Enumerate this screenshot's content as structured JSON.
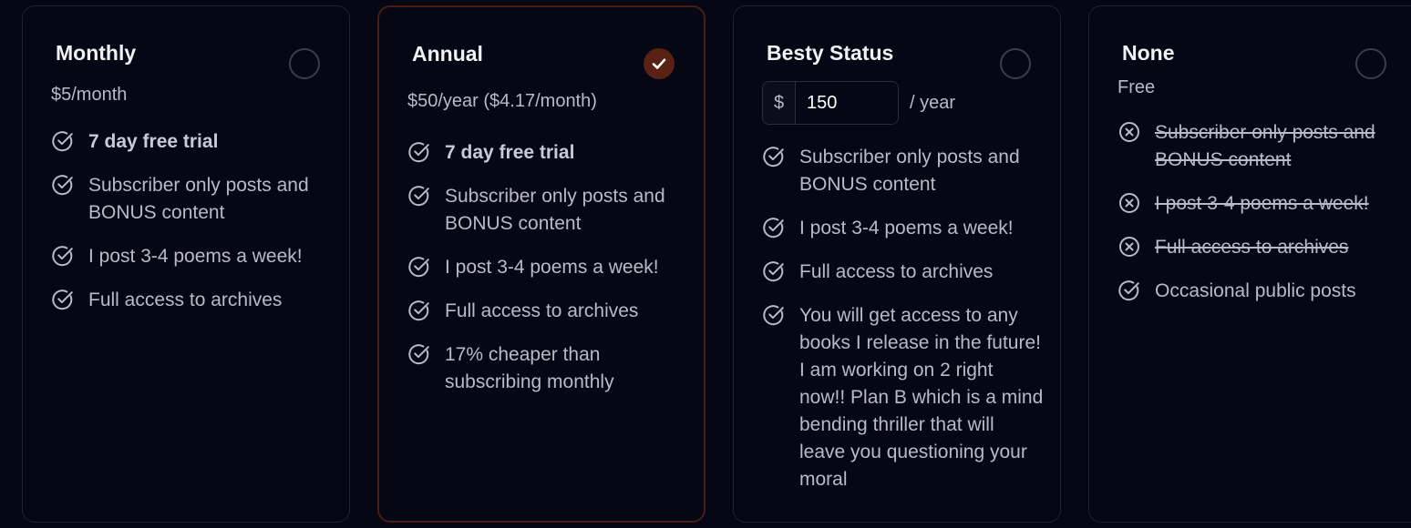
{
  "colors": {
    "background": "#050714",
    "card_border": "#20232f",
    "selected_border": "#4a1d12",
    "selected_radio": "#5a2214",
    "text": "#b9bac4",
    "title": "#f1f1f5"
  },
  "plans": [
    {
      "title": "Monthly",
      "price": "$5/month",
      "selected": false,
      "features": [
        {
          "text": "7 day free trial",
          "icon": "check-circle-icon",
          "bold": true
        },
        {
          "text": "Subscriber only posts and BONUS content",
          "icon": "check-circle-icon"
        },
        {
          "text": "I post 3-4 poems a week!",
          "icon": "check-circle-icon"
        },
        {
          "text": "Full access to archives",
          "icon": "check-circle-icon"
        }
      ]
    },
    {
      "title": "Annual",
      "price": "$50/year ($4.17/month)",
      "selected": true,
      "features": [
        {
          "text": "7 day free trial",
          "icon": "check-circle-icon",
          "bold": true
        },
        {
          "text": "Subscriber only posts and BONUS content",
          "icon": "check-circle-icon"
        },
        {
          "text": "I post 3-4 poems a week!",
          "icon": "check-circle-icon"
        },
        {
          "text": "Full access to archives",
          "icon": "check-circle-icon"
        },
        {
          "text": "17% cheaper than subscribing monthly",
          "icon": "check-circle-icon"
        }
      ]
    },
    {
      "title": "Besty Status",
      "selected": false,
      "amount": {
        "currency": "$",
        "value": "150",
        "period": "/ year"
      },
      "features": [
        {
          "text": "Subscriber only posts and BONUS content",
          "icon": "check-circle-icon"
        },
        {
          "text": "I post 3-4 poems a week!",
          "icon": "check-circle-icon"
        },
        {
          "text": "Full access to archives",
          "icon": "check-circle-icon"
        },
        {
          "text": "You will get access to any books I release in the future! I am working on 2 right now!! Plan B which is a mind bending thriller that will leave you questioning your moral",
          "icon": "check-circle-icon"
        }
      ]
    },
    {
      "title": "None",
      "price": "Free",
      "selected": false,
      "features": [
        {
          "text": "Subscriber only posts and BONUS content",
          "icon": "x-circle-icon",
          "struck": true
        },
        {
          "text": "I post 3-4 poems a week!",
          "icon": "x-circle-icon",
          "struck": true
        },
        {
          "text": "Full access to archives",
          "icon": "x-circle-icon",
          "struck": true
        },
        {
          "text": "Occasional public posts",
          "icon": "check-circle-icon"
        }
      ]
    }
  ]
}
